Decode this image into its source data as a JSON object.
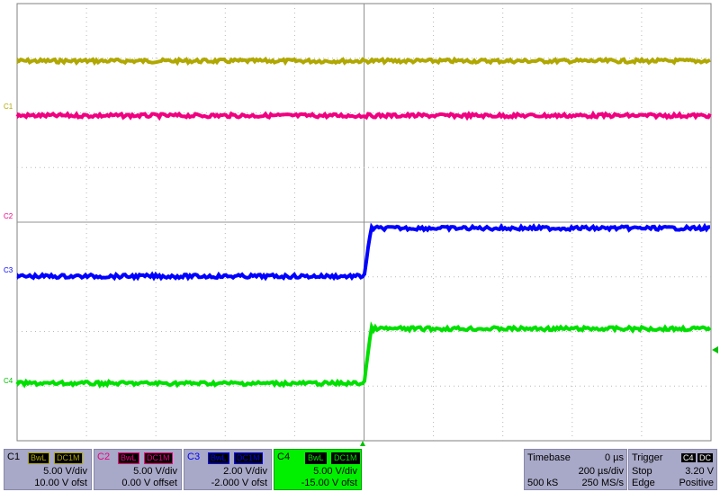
{
  "chart_data": {
    "type": "line",
    "grid": true,
    "x_divisions": 10,
    "y_divisions": 8,
    "series": [
      {
        "name": "C1",
        "color": "#b0a800",
        "level_div": 2.95,
        "step_div": 0.0
      },
      {
        "name": "C2",
        "color": "#f00080",
        "level_div": 1.95,
        "step_div": 0.0
      },
      {
        "name": "C3",
        "color": "#0000ff",
        "level_div": -0.99,
        "step_div": 0.88
      },
      {
        "name": "C4",
        "color": "#00e000",
        "level_div": -2.95,
        "step_div": 1.0
      }
    ],
    "markers": {
      "c1": "C1",
      "c2": "C2",
      "c3": "C3",
      "c4": "C4"
    },
    "right_marker_color": "#00c000"
  },
  "channels": [
    {
      "name": "C1",
      "bw": "BwL",
      "coupling": "DC1M",
      "scale": "5.00 V/div",
      "offset": "10.00 V ofst",
      "color": "#b0a800"
    },
    {
      "name": "C2",
      "bw": "BwL",
      "coupling": "DC1M",
      "scale": "5.00 V/div",
      "offset": "0.00 V offset",
      "color": "#f00080"
    },
    {
      "name": "C3",
      "bw": "BwL",
      "coupling": "DC1M",
      "scale": "2.00 V/div",
      "offset": "-2.000 V ofst",
      "color": "#0000ff"
    },
    {
      "name": "C4",
      "bw": "BwL",
      "coupling": "DC1M",
      "scale": "5.00 V/div",
      "offset": "-15.00 V ofst",
      "color": "#00c000"
    }
  ],
  "timebase": {
    "label": "Timebase",
    "delay": "0 µs",
    "scale": "200 µs/div",
    "samples": "500 kS",
    "rate": "250 MS/s"
  },
  "trigger": {
    "label": "Trigger",
    "source": "C4",
    "coupling": "DC",
    "mode": "Stop",
    "level": "3.20 V",
    "type": "Edge",
    "slope": "Positive"
  }
}
